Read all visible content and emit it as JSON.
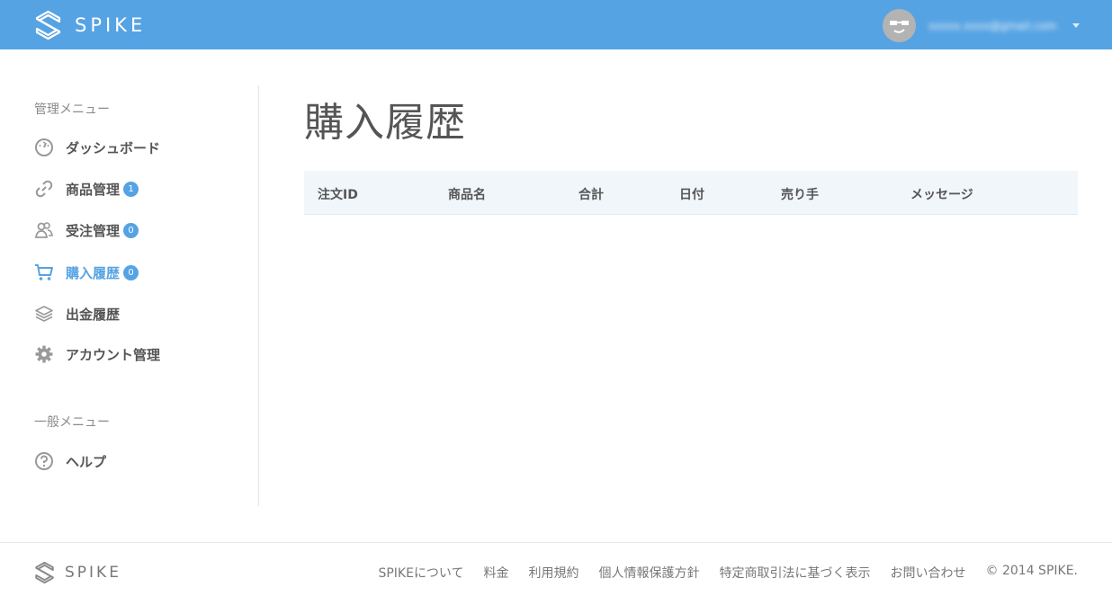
{
  "header": {
    "brand": "SPIKE",
    "user_email": "xxxxx.xxxx@gmail.com",
    "brand_color": "#56a3e3"
  },
  "sidebar": {
    "admin_heading": "管理メニュー",
    "general_heading": "一般メニュー",
    "items": [
      {
        "label": "ダッシュボード",
        "icon": "dashboard-gauge-icon"
      },
      {
        "label": "商品管理",
        "icon": "link-icon",
        "badge": "1"
      },
      {
        "label": "受注管理",
        "icon": "users-icon",
        "badge": "0"
      },
      {
        "label": "購入履歴",
        "icon": "cart-icon",
        "badge": "0",
        "active": true
      },
      {
        "label": "出金履歴",
        "icon": "layers-icon"
      },
      {
        "label": "アカウント管理",
        "icon": "gear-icon"
      }
    ],
    "general_items": [
      {
        "label": "ヘルプ",
        "icon": "help-circle-icon"
      }
    ]
  },
  "main": {
    "title": "購入履歴",
    "columns": [
      "注文ID",
      "商品名",
      "合計",
      "日付",
      "売り手",
      "メッセージ"
    ]
  },
  "footer": {
    "brand": "SPIKE",
    "links": [
      "SPIKEについて",
      "料金",
      "利用規約",
      "個人情報保護方針",
      "特定商取引法に基づく表示",
      "お問い合わせ"
    ],
    "copyright": "© 2014 SPIKE."
  }
}
